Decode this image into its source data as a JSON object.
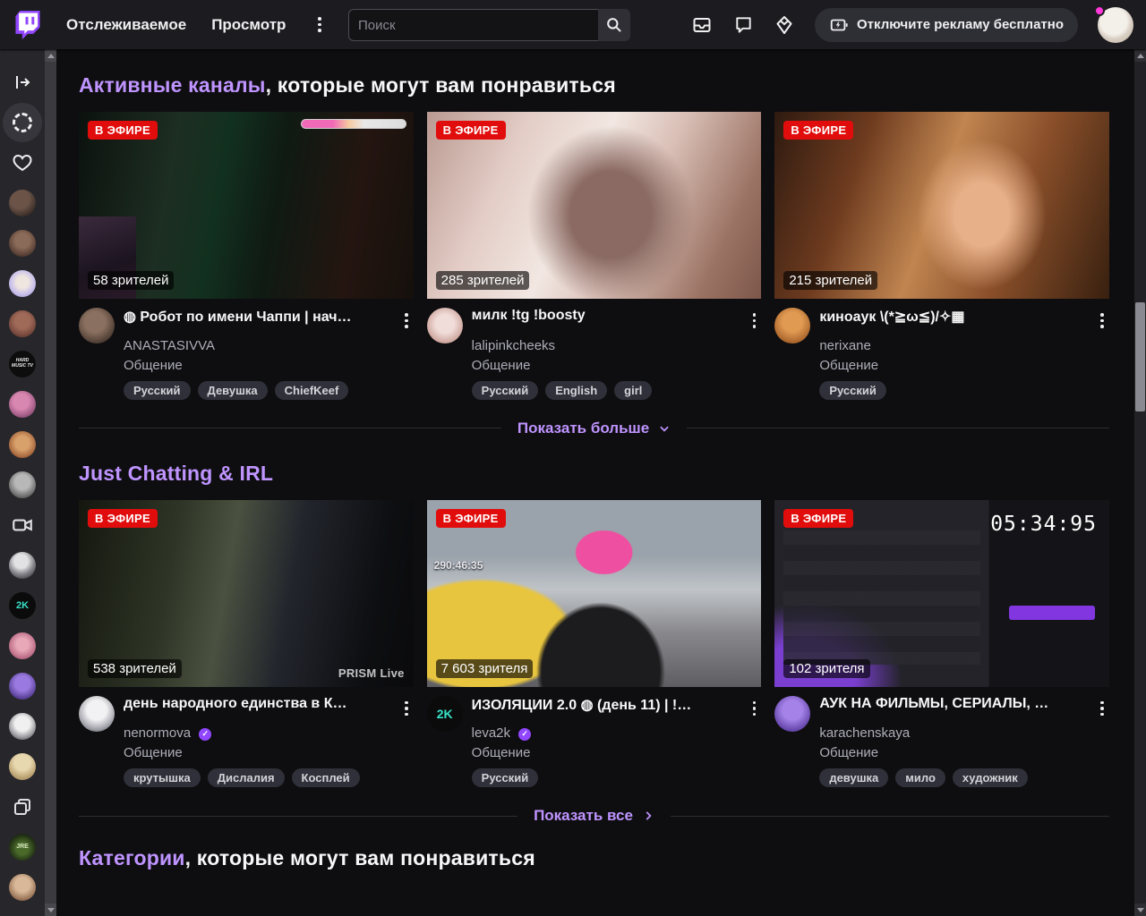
{
  "colors": {
    "accent": "#bf94ff",
    "brand": "#9146ff",
    "live": "#e10d0d",
    "notification_dot": "#ff38db",
    "navbar_bg": "#1c1c20",
    "page_bg": "#0e0e10"
  },
  "navbar": {
    "logo_icon": "twitch-logo",
    "following_label": "Отслеживаемое",
    "browse_label": "Просмотр",
    "more_icon": "kebab-menu",
    "search_placeholder": "Поиск",
    "search_icon": "magnifier",
    "inbox_icon": "inbox-tray",
    "whispers_icon": "chat-bubble",
    "drops_icon": "drops-diamond",
    "ad_free_icon": "ad-lightning",
    "ad_free_label": "Отключите рекламу бесплатно"
  },
  "sidebar": {
    "collapse_icon": "collapse-arrow",
    "stories_icon": "stories-ring",
    "heart_icon": "heart",
    "camera_icon": "video-camera",
    "copy_icon": "copy-squares",
    "avatar_labels": {
      "hardmusic": "HARD MUSIC TV",
      "k2": "2K",
      "jre": "JRE"
    }
  },
  "live_badge": "В ЭФИРЕ",
  "sections": [
    {
      "title_link": "Активные каналы",
      "title_rest": ", которые могут вам понравиться",
      "footer_label": "Показать больше",
      "cards": [
        {
          "viewers": "58 зрителей",
          "title": "◍ Робот по имени Чаппи | нач…",
          "channel": "ANASTASIVVA",
          "category": "Общение",
          "tags": [
            "Русский",
            "Девушка",
            "ChiefKeef"
          ]
        },
        {
          "viewers": "285 зрителей",
          "title": "милк !tg !boosty",
          "channel": "lalipinkcheeks",
          "category": "Общение",
          "tags": [
            "Русский",
            "English",
            "girl"
          ]
        },
        {
          "viewers": "215 зрителей",
          "title": "киноаук \\(*≧ω≦)/✧▦",
          "channel": "nerixane",
          "category": "Общение",
          "tags": [
            "Русский"
          ]
        }
      ]
    },
    {
      "title_link": "Just Chatting & IRL",
      "title_rest": "",
      "footer_label": "Показать все",
      "cards": [
        {
          "viewers": "538 зрителей",
          "title": "день народного единства в К…",
          "channel": "nenormova",
          "category": "Общение",
          "tags": [
            "крутышка",
            "Дислалия",
            "Косплей"
          ],
          "watermark": "PRISM Live"
        },
        {
          "viewers": "7 603 зрителя",
          "title": "ИЗОЛЯЦИИ 2.0 ◍ (день 11) | !…",
          "channel": "leva2k",
          "category": "Общение",
          "tags": [
            "Русский"
          ],
          "timer": "290:46:35",
          "avatar_label": "2K"
        },
        {
          "viewers": "102 зрителя",
          "title": "АУК НА ФИЛЬМЫ, СЕРИАЛЫ, …",
          "channel": "karachenskaya",
          "category": "Общение",
          "tags": [
            "девушка",
            "мило",
            "художник"
          ],
          "timer": "05:34:95"
        }
      ]
    },
    {
      "title_link": "Категории",
      "title_rest": ", которые могут вам понравиться"
    }
  ]
}
